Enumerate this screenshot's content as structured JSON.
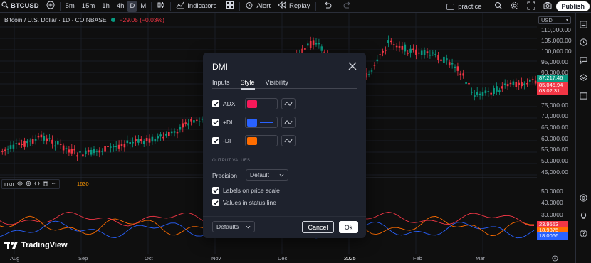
{
  "toolbar": {
    "symbol": "BTCUSD",
    "intervals": [
      "5m",
      "15m",
      "1h",
      "4h",
      "D",
      "M"
    ],
    "active_interval": "D",
    "indicators_label": "Indicators",
    "alert_label": "Alert",
    "replay_label": "Replay",
    "account_label": "practice",
    "publish_label": "Publish"
  },
  "legend": {
    "title": "Bitcoin / U.S. Dollar · 1D · COINBASE",
    "change": "−29.05 (−0.03%)"
  },
  "price_axis": {
    "currency": "USD",
    "labels": [
      "110,000.00",
      "105,000.00",
      "100,000.00",
      "95,000.00",
      "90,000.00",
      "75,000.00",
      "70,000.00",
      "65,000.00",
      "60,000.00",
      "55,000.00",
      "50,000.00",
      "45,000.00"
    ],
    "tag_green": "87,217.46",
    "tag_red_price": "85,045.94",
    "tag_red_timer": "03:02:31",
    "dmi_labels": [
      "50.0000",
      "40.0000",
      "30.0000",
      "20.0000",
      "10.0000"
    ],
    "dmi_tags": [
      {
        "value": "23.9553",
        "color": "#f23645"
      },
      {
        "value": "18.9375",
        "color": "#ff6d00"
      },
      {
        "value": "18.0066",
        "color": "#2962ff"
      }
    ]
  },
  "time_axis": [
    "Aug",
    "Sep",
    "Oct",
    "Nov",
    "Dec",
    "2025",
    "Feb",
    "Mar"
  ],
  "dmi_pane": {
    "label": "DMI",
    "value": "1630"
  },
  "watermark": "TradingView",
  "dialog": {
    "title": "DMI",
    "tabs": [
      "Inputs",
      "Style",
      "Visibility"
    ],
    "active_tab": "Style",
    "plots": [
      {
        "label": "ADX",
        "color": "#f7195a",
        "checked": true
      },
      {
        "label": "+DI",
        "color": "#2962ff",
        "checked": true
      },
      {
        "label": "-DI",
        "color": "#ff6d00",
        "checked": true
      }
    ],
    "section_output": "OUTPUT VALUES",
    "precision_label": "Precision",
    "precision_value": "Default",
    "labels_on_price_scale": "Labels on price scale",
    "values_in_status_line": "Values in status line",
    "defaults_label": "Defaults",
    "cancel_label": "Cancel",
    "ok_label": "Ok"
  }
}
